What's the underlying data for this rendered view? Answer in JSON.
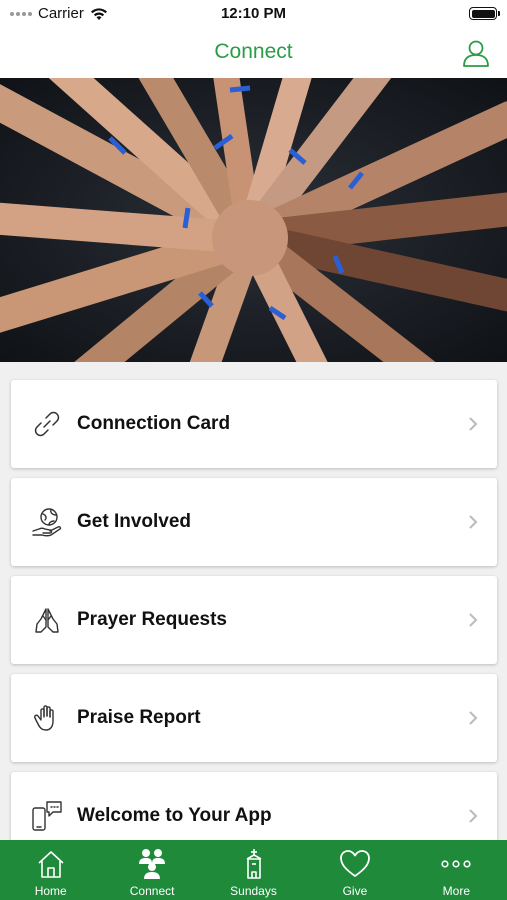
{
  "status_bar": {
    "carrier": "Carrier",
    "time": "12:10 PM"
  },
  "nav": {
    "title": "Connect",
    "title_color": "#2a9c48"
  },
  "hero": {
    "description_icon": "group-hands-photo"
  },
  "list": {
    "items": [
      {
        "label": "Connection Card",
        "icon": "link-icon"
      },
      {
        "label": "Get Involved",
        "icon": "globe-hand-icon"
      },
      {
        "label": "Prayer Requests",
        "icon": "praying-hands-icon"
      },
      {
        "label": "Praise Report",
        "icon": "raised-hand-icon"
      },
      {
        "label": "Welcome to Your App",
        "icon": "phone-chat-icon"
      }
    ]
  },
  "tab_bar": {
    "background": "#1e8a3a",
    "tabs": [
      {
        "label": "Home",
        "icon": "home-icon"
      },
      {
        "label": "Connect",
        "icon": "people-icon",
        "active": true
      },
      {
        "label": "Sundays",
        "icon": "church-icon"
      },
      {
        "label": "Give",
        "icon": "heart-icon"
      },
      {
        "label": "More",
        "icon": "more-icon"
      }
    ]
  }
}
